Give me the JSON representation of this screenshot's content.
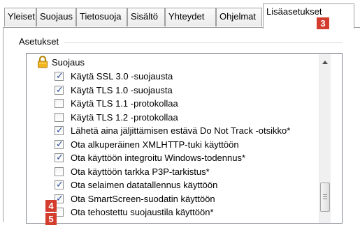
{
  "tabs": [
    {
      "label": "Yleiset"
    },
    {
      "label": "Suojaus"
    },
    {
      "label": "Tietosuoja"
    },
    {
      "label": "Sisältö"
    },
    {
      "label": "Yhteydet"
    },
    {
      "label": "Ohjelmat"
    },
    {
      "label": "Lisäasetukset"
    }
  ],
  "badges": [
    "3",
    "4",
    "5"
  ],
  "group_label": "Asetukset",
  "section": {
    "label": "Suojaus",
    "icon": "lock-icon"
  },
  "items": [
    {
      "label": "Käytä SSL 3.0 -suojausta",
      "checked": true
    },
    {
      "label": "Käytä TLS 1.0 -suojausta",
      "checked": true
    },
    {
      "label": "Käytä TLS 1.1 -protokollaa",
      "checked": false
    },
    {
      "label": "Käytä TLS 1.2 -protokollaa",
      "checked": false
    },
    {
      "label": "Lähetä aina jäljittämisen estävä Do Not Track -otsikko*",
      "checked": true
    },
    {
      "label": "Ota alkuperäinen XMLHTTP-tuki käyttöön",
      "checked": true
    },
    {
      "label": "Ota käyttöön integroitu Windows-todennus*",
      "checked": true
    },
    {
      "label": "Ota käyttöön tarkka P3P-tarkistus*",
      "checked": false
    },
    {
      "label": "Ota selaimen datatallennus käyttöön",
      "checked": true
    },
    {
      "label": "Ota SmartScreen-suodatin käyttöön",
      "checked": true
    },
    {
      "label": "Ota tehostettu suojaustila käyttöön*",
      "checked": false
    }
  ],
  "colors": {
    "badge": "#d43c2e",
    "check": "#2b4e9b"
  }
}
